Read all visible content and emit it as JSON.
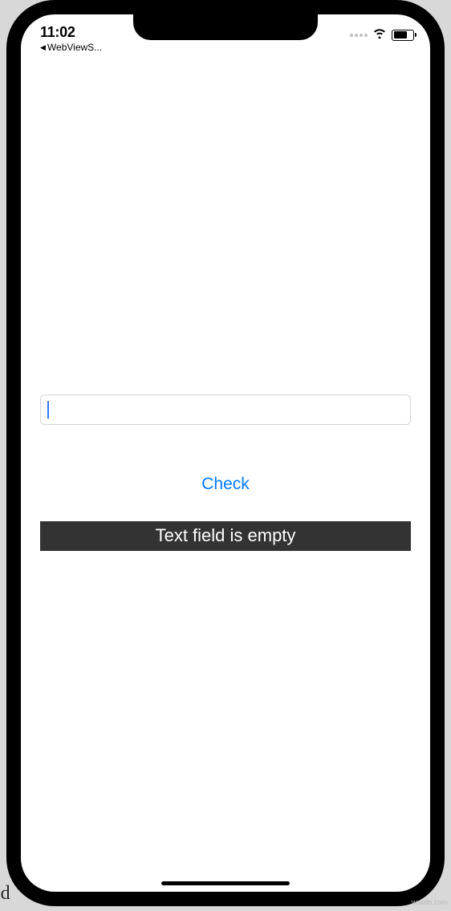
{
  "status_bar": {
    "time": "11:02",
    "back_app": "WebViewS..."
  },
  "input": {
    "value": ""
  },
  "check_button": {
    "label": "Check"
  },
  "result": {
    "text": "Text field is empty"
  },
  "background": {
    "left_text": "ed ",
    "watermark": "wsxdn.com"
  }
}
